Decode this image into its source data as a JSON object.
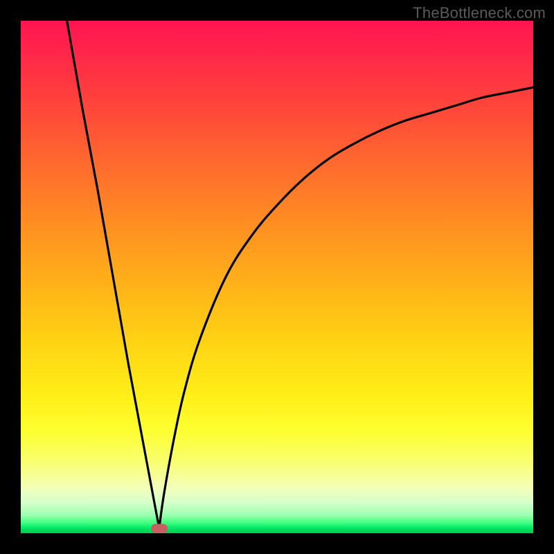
{
  "attribution": "TheBottleneck.com",
  "colors": {
    "frame": "#000000",
    "gradient_top": "#ff1452",
    "gradient_bottom": "#00c851",
    "curve": "#000000",
    "marker": "#c76161"
  },
  "chart_data": {
    "type": "line",
    "title": "",
    "xlabel": "",
    "ylabel": "",
    "xlim": [
      0,
      100
    ],
    "ylim": [
      0,
      100
    ],
    "grid": false,
    "legend": false,
    "annotations": [
      {
        "kind": "marker",
        "x": 27,
        "y": 1,
        "shape": "rounded-rect",
        "color": "#c76161"
      }
    ],
    "series": [
      {
        "name": "left-branch",
        "kind": "line",
        "x": [
          9,
          12,
          15,
          18,
          21,
          24,
          27
        ],
        "y": [
          100,
          83,
          67,
          50,
          33,
          17,
          1
        ]
      },
      {
        "name": "right-branch",
        "kind": "line",
        "x": [
          27,
          28,
          30,
          32,
          35,
          40,
          45,
          50,
          55,
          60,
          65,
          70,
          75,
          80,
          85,
          90,
          95,
          100
        ],
        "y": [
          1,
          8,
          19,
          28,
          38,
          50,
          58,
          64,
          69,
          73,
          76,
          78.5,
          80.5,
          82,
          83.5,
          85,
          86,
          87
        ]
      }
    ]
  }
}
